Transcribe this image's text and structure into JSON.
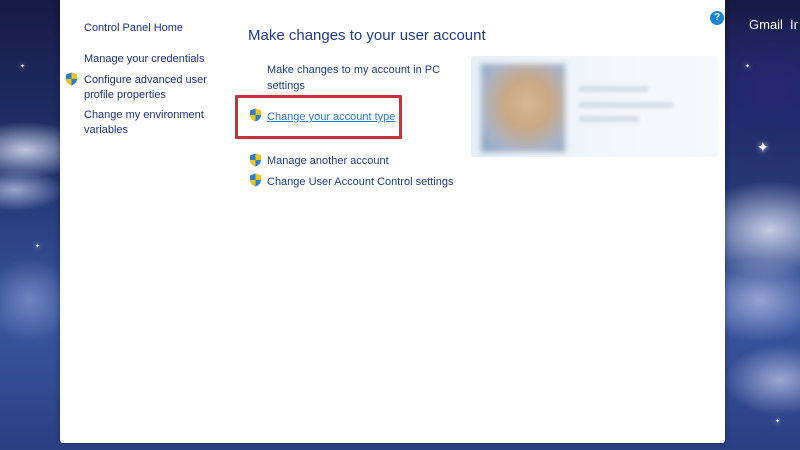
{
  "topbar": {
    "gmail_label": "Gmail",
    "next_label": "Ir"
  },
  "window": {
    "help_label": "?"
  },
  "nav": {
    "home": "Control Panel Home",
    "items": [
      {
        "label": "Manage your credentials"
      },
      {
        "label": "Configure advanced user profile properties"
      },
      {
        "label": "Change my environment variables"
      }
    ]
  },
  "main": {
    "title": "Make changes to your user account",
    "tasks": [
      {
        "label": "Make changes to my account in PC settings"
      },
      {
        "label": "Change your account type"
      },
      {
        "label": "Manage another account"
      },
      {
        "label": "Change User Account Control settings"
      }
    ]
  },
  "colors": {
    "link": "#1e3c8c",
    "highlight_link": "#2d78d8",
    "callout_border": "#c8323c"
  }
}
